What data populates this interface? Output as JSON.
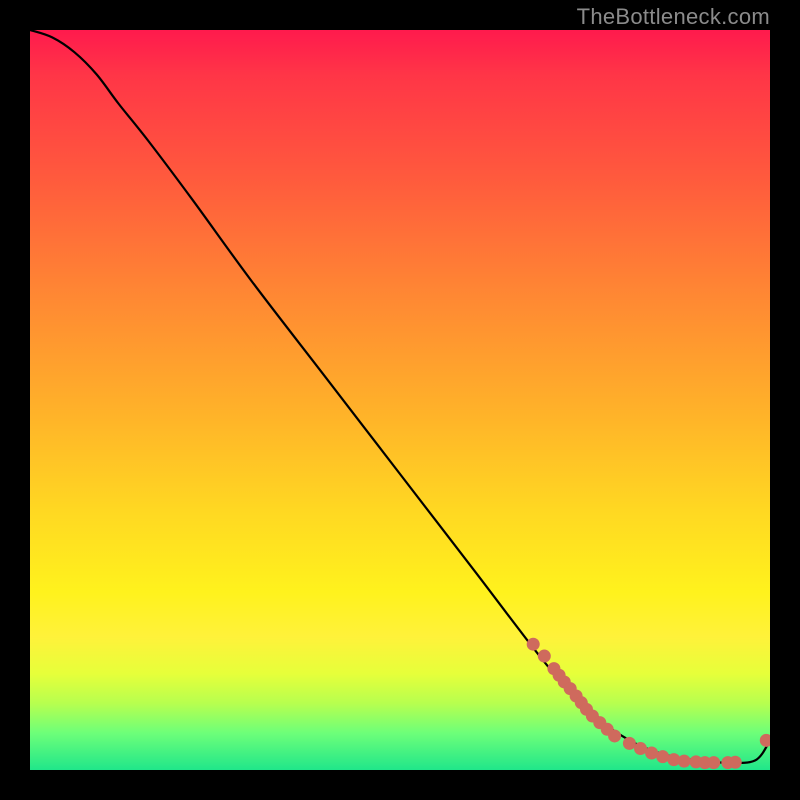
{
  "watermark": "TheBottleneck.com",
  "chart_data": {
    "type": "line",
    "title": "",
    "xlabel": "",
    "ylabel": "",
    "xlim": [
      0,
      100
    ],
    "ylim": [
      0,
      100
    ],
    "grid": false,
    "legend": false,
    "note": "Axes are unlabeled; values are estimated percentages of the plot area.",
    "series": [
      {
        "name": "curve",
        "style": "line",
        "color": "#000000",
        "x": [
          0,
          3,
          6,
          9,
          12,
          16,
          22,
          30,
          40,
          50,
          60,
          70,
          75,
          78,
          82,
          86,
          90,
          94,
          98,
          100
        ],
        "y": [
          100,
          99,
          97,
          94,
          90,
          85,
          77,
          66,
          53,
          40,
          27,
          14,
          9,
          6,
          3.5,
          2,
          1.3,
          1,
          1.3,
          4
        ]
      },
      {
        "name": "points",
        "style": "scatter",
        "color": "#cf6a5d",
        "x": [
          68,
          69.5,
          70.8,
          71.5,
          72.2,
          73,
          73.8,
          74.5,
          75.2,
          76,
          77,
          78,
          79,
          81,
          82.5,
          84,
          85.5,
          87,
          88.4,
          90,
          91.2,
          92.4,
          94.3,
          95.3,
          99.5
        ],
        "y": [
          17,
          15.4,
          13.7,
          12.8,
          11.9,
          11,
          10,
          9.1,
          8.2,
          7.3,
          6.4,
          5.5,
          4.6,
          3.6,
          2.9,
          2.3,
          1.8,
          1.4,
          1.2,
          1.1,
          1.0,
          1.0,
          1.0,
          1.05,
          4.0
        ]
      }
    ]
  }
}
